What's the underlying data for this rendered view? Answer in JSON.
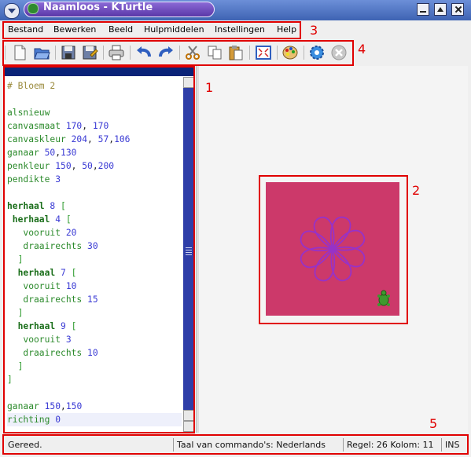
{
  "window": {
    "title": "Naamloos - KTurtle",
    "icons": {
      "app": "turtle-icon",
      "menu": "window-menu-icon",
      "minimize": "minimize-icon",
      "maximize": "maximize-icon",
      "close": "close-icon"
    }
  },
  "menubar": {
    "items": [
      "Bestand",
      "Bewerken",
      "Beeld",
      "Hulpmiddelen",
      "Instellingen",
      "Help"
    ]
  },
  "toolbar": {
    "buttons": [
      {
        "name": "new",
        "icon": "new-document-icon"
      },
      {
        "name": "open",
        "icon": "open-folder-icon"
      },
      {
        "name": "save",
        "icon": "save-icon"
      },
      {
        "name": "save-as",
        "icon": "save-as-icon"
      },
      {
        "name": "print",
        "icon": "printer-icon"
      },
      {
        "name": "undo",
        "icon": "undo-icon"
      },
      {
        "name": "redo",
        "icon": "redo-icon"
      },
      {
        "name": "cut",
        "icon": "scissors-icon"
      },
      {
        "name": "copy",
        "icon": "copy-icon"
      },
      {
        "name": "paste",
        "icon": "paste-icon"
      },
      {
        "name": "fullscreen",
        "icon": "fullscreen-icon"
      },
      {
        "name": "color-picker",
        "icon": "palette-icon"
      },
      {
        "name": "run",
        "icon": "gear-icon"
      },
      {
        "name": "stop",
        "icon": "stop-icon"
      }
    ]
  },
  "editor": {
    "lines": [
      [
        {
          "t": "# Bloem 2",
          "c": "cmt"
        }
      ],
      [],
      [
        {
          "t": "alsnieuw",
          "c": "cmd"
        }
      ],
      [
        {
          "t": "canvasmaat",
          "c": "cmd"
        },
        {
          "t": " 170",
          "c": "num"
        },
        {
          "t": ", ",
          "c": "pl"
        },
        {
          "t": "170",
          "c": "num"
        }
      ],
      [
        {
          "t": "canvaskleur",
          "c": "cmd"
        },
        {
          "t": " 204",
          "c": "num"
        },
        {
          "t": ", ",
          "c": "pl"
        },
        {
          "t": "57",
          "c": "num"
        },
        {
          "t": ",",
          "c": "pl"
        },
        {
          "t": "106",
          "c": "num"
        }
      ],
      [
        {
          "t": "ganaar",
          "c": "cmd"
        },
        {
          "t": " 50",
          "c": "num"
        },
        {
          "t": ",",
          "c": "pl"
        },
        {
          "t": "130",
          "c": "num"
        }
      ],
      [
        {
          "t": "penkleur",
          "c": "cmd"
        },
        {
          "t": " 150",
          "c": "num"
        },
        {
          "t": ", ",
          "c": "pl"
        },
        {
          "t": "50",
          "c": "num"
        },
        {
          "t": ",",
          "c": "pl"
        },
        {
          "t": "200",
          "c": "num"
        }
      ],
      [
        {
          "t": "pendikte",
          "c": "cmd"
        },
        {
          "t": " 3",
          "c": "num"
        }
      ],
      [],
      [
        {
          "t": "herhaal",
          "c": "kw"
        },
        {
          "t": " 8",
          "c": "num"
        },
        {
          "t": " [",
          "c": "br"
        }
      ],
      [
        {
          "t": " herhaal",
          "c": "kw"
        },
        {
          "t": " 4",
          "c": "num"
        },
        {
          "t": " [",
          "c": "br"
        }
      ],
      [
        {
          "t": "   vooruit",
          "c": "cmd"
        },
        {
          "t": " 20",
          "c": "num"
        }
      ],
      [
        {
          "t": "   draairechts",
          "c": "cmd"
        },
        {
          "t": " 30",
          "c": "num"
        }
      ],
      [
        {
          "t": "  ]",
          "c": "br"
        }
      ],
      [
        {
          "t": "  herhaal",
          "c": "kw"
        },
        {
          "t": " 7",
          "c": "num"
        },
        {
          "t": " [",
          "c": "br"
        }
      ],
      [
        {
          "t": "   vooruit",
          "c": "cmd"
        },
        {
          "t": " 10",
          "c": "num"
        }
      ],
      [
        {
          "t": "   draairechts",
          "c": "cmd"
        },
        {
          "t": " 15",
          "c": "num"
        }
      ],
      [
        {
          "t": "  ]",
          "c": "br"
        }
      ],
      [
        {
          "t": "  herhaal",
          "c": "kw"
        },
        {
          "t": " 9",
          "c": "num"
        },
        {
          "t": " [",
          "c": "br"
        }
      ],
      [
        {
          "t": "   vooruit",
          "c": "cmd"
        },
        {
          "t": " 3",
          "c": "num"
        }
      ],
      [
        {
          "t": "   draairechts",
          "c": "cmd"
        },
        {
          "t": " 10",
          "c": "num"
        }
      ],
      [
        {
          "t": "  ]",
          "c": "br"
        }
      ],
      [
        {
          "t": "]",
          "c": "br"
        }
      ],
      [],
      [
        {
          "t": "ganaar",
          "c": "cmd"
        },
        {
          "t": " 150",
          "c": "num"
        },
        {
          "t": ",",
          "c": "pl"
        },
        {
          "t": "150",
          "c": "num"
        }
      ],
      [
        {
          "t": "richting",
          "c": "cmd"
        },
        {
          "t": " 0",
          "c": "num"
        }
      ]
    ]
  },
  "canvas": {
    "background": "#cc396a",
    "pen_color": "#9632c8"
  },
  "statusbar": {
    "message": "Gereed.",
    "language": "Taal van commando's: Nederlands",
    "position": "Regel: 26 Kolom: 11",
    "mode": "INS"
  },
  "annotations": [
    "1",
    "2",
    "3",
    "4",
    "5"
  ],
  "colors": {
    "annotation": "#e00000",
    "titlebar": "#3e63b3",
    "scroll": "#2e3ea8"
  }
}
